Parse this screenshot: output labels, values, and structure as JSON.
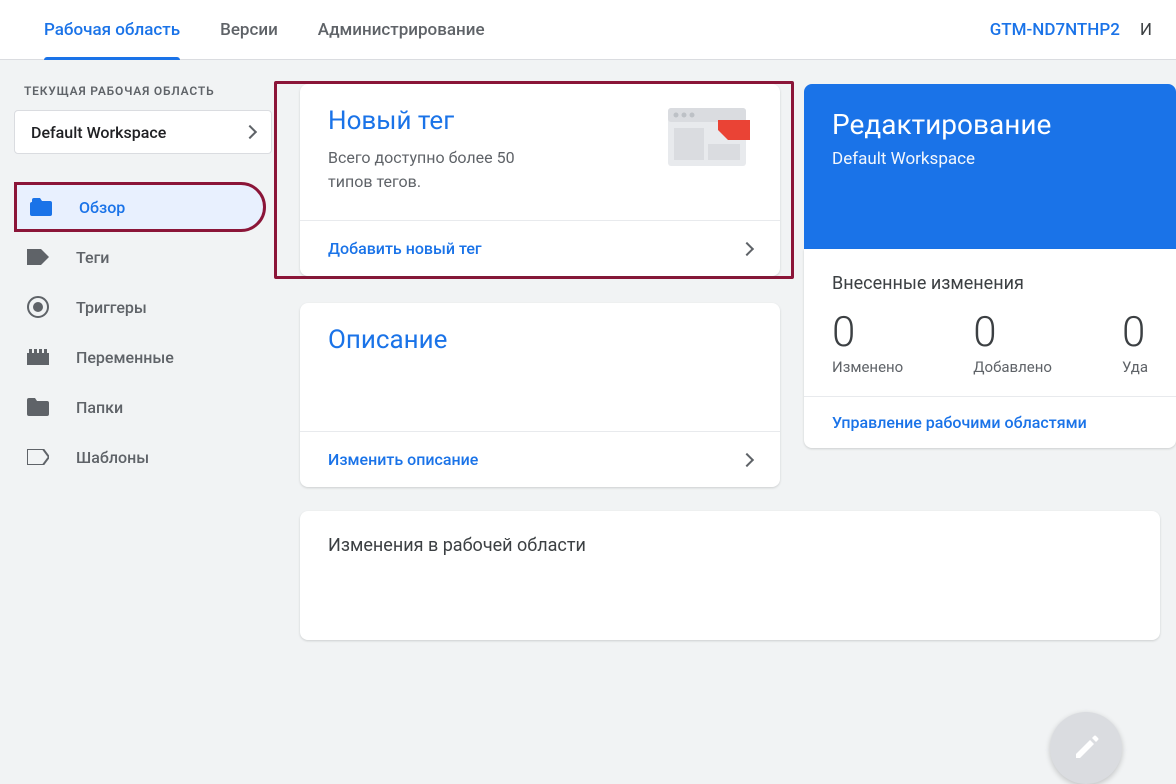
{
  "tabs": {
    "workspace": "Рабочая область",
    "versions": "Версии",
    "admin": "Администрирование"
  },
  "container_id": "GTM-ND7NTHP2",
  "truncated_text": "И",
  "workspace_section": {
    "label": "ТЕКУЩАЯ РАБОЧАЯ ОБЛАСТЬ",
    "current": "Default Workspace"
  },
  "nav": {
    "overview": "Обзор",
    "tags": "Теги",
    "triggers": "Триггеры",
    "variables": "Переменные",
    "folders": "Папки",
    "templates": "Шаблоны"
  },
  "new_tag": {
    "title": "Новый тег",
    "subtitle": "Всего доступно более 50 типов тегов.",
    "action": "Добавить новый тег"
  },
  "description": {
    "title": "Описание",
    "action": "Изменить описание"
  },
  "editing": {
    "title": "Редактирование",
    "subtitle": "Default Workspace"
  },
  "changes": {
    "title": "Внесенные изменения",
    "stats": [
      {
        "value": "0",
        "label": "Изменено"
      },
      {
        "value": "0",
        "label": "Добавлено"
      },
      {
        "value": "0",
        "label": "Уда"
      }
    ],
    "manage_link": "Управление рабочими областями"
  },
  "workspace_changes": {
    "title": "Изменения в рабочей области"
  }
}
